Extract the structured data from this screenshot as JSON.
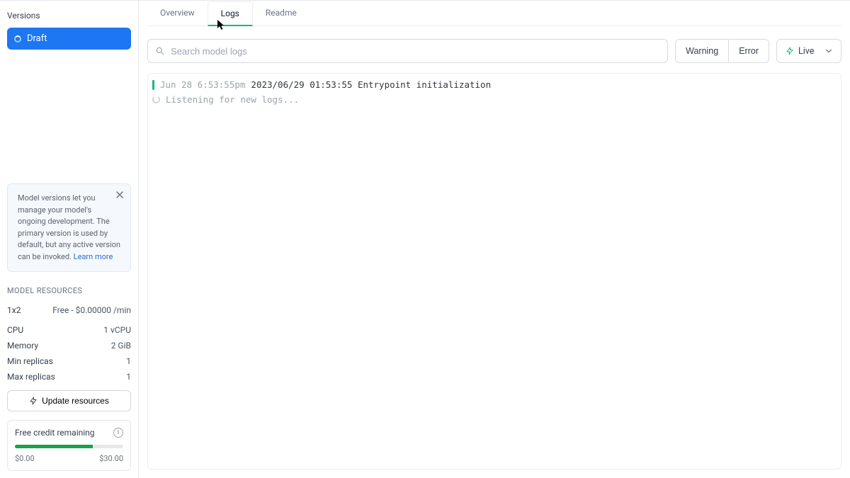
{
  "sidebar": {
    "title": "Versions",
    "draft_label": "Draft",
    "info_card": {
      "text_prefix": "Model versions let you manage your model's ongoing development. The primary version is used by default, but any active version can be invoked. ",
      "learn_more": "Learn more"
    },
    "resources": {
      "label": "MODEL RESOURCES",
      "tier": "1x2",
      "tier_price": "Free - $0.00000 /min",
      "rows": {
        "cpu_label": "CPU",
        "cpu_value": "1 vCPU",
        "mem_label": "Memory",
        "mem_value": "2 GiB",
        "min_label": "Min replicas",
        "min_value": "1",
        "max_label": "Max replicas",
        "max_value": "1"
      },
      "update_button": "Update resources"
    },
    "credit": {
      "label": "Free credit remaining",
      "min": "$0.00",
      "max": "$30.00"
    }
  },
  "tabs": {
    "overview": "Overview",
    "logs": "Logs",
    "readme": "Readme"
  },
  "controls": {
    "search_placeholder": "Search model logs",
    "warning": "Warning",
    "error": "Error",
    "live": "Live"
  },
  "logs": {
    "entries": [
      {
        "local_ts": "Jun 28 6:53:55pm",
        "utc_ts": "2023/06/29 01:53:55",
        "message": "Entrypoint initialization"
      }
    ],
    "listening": "Listening for new logs..."
  }
}
